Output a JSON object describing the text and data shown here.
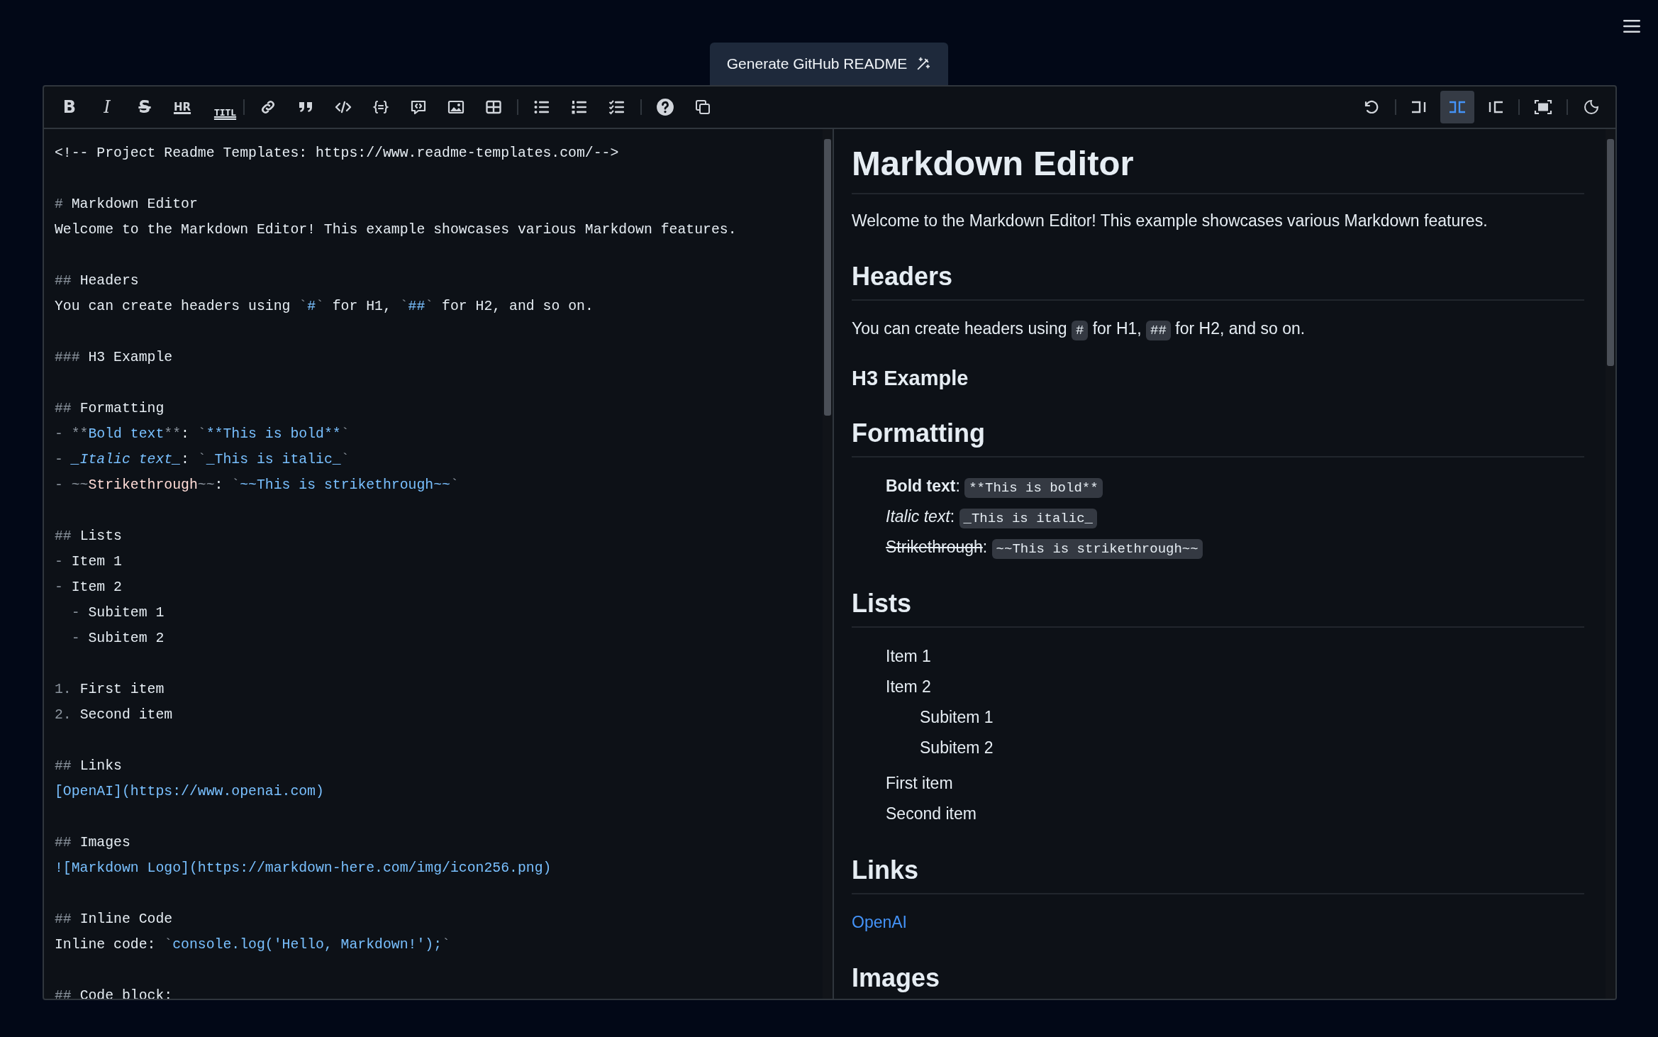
{
  "generate_button": {
    "label": "Generate GitHub README"
  },
  "toolbar": {
    "left_groups": [
      [
        {
          "kind": "label",
          "label": "B"
        },
        {
          "kind": "label",
          "label": "I"
        },
        {
          "kind": "label",
          "label": "S"
        },
        {
          "kind": "label",
          "label": "HR"
        },
        {
          "kind": "label",
          "label": "TITL"
        }
      ],
      [
        {
          "kind": "link"
        },
        {
          "kind": "quote"
        },
        {
          "kind": "code"
        },
        {
          "kind": "code-block"
        },
        {
          "kind": "comment"
        },
        {
          "kind": "image"
        },
        {
          "kind": "table"
        }
      ],
      [
        {
          "kind": "bullet-list"
        },
        {
          "kind": "numbered-list"
        },
        {
          "kind": "task-list"
        }
      ],
      [
        {
          "kind": "help"
        },
        {
          "kind": "copy"
        }
      ]
    ],
    "right_groups": [
      [
        {
          "kind": "undo",
          "selected": false
        }
      ],
      [
        {
          "kind": "pane-editor",
          "selected": false
        },
        {
          "kind": "pane-split",
          "selected": true
        },
        {
          "kind": "pane-preview",
          "selected": false
        }
      ],
      [
        {
          "kind": "fullscreen",
          "selected": false
        }
      ],
      [
        {
          "kind": "theme",
          "selected": false
        }
      ]
    ]
  },
  "editor": {
    "paragraphs": [
      {
        "lines": [
          [
            {
              "kind": "plain",
              "text": "<!-- Project Readme Templates: https://www.readme-templates.com/-->"
            }
          ]
        ]
      },
      {
        "lines": [
          [
            {
              "kind": "mark",
              "text": "# "
            },
            {
              "kind": "plain",
              "text": "Markdown Editor"
            }
          ],
          [
            {
              "kind": "plain",
              "text": "Welcome to the Markdown Editor! This example showcases various Markdown features."
            }
          ]
        ]
      },
      {
        "lines": [
          [
            {
              "kind": "mark",
              "text": "## "
            },
            {
              "kind": "plain",
              "text": "Headers"
            }
          ],
          [
            {
              "kind": "plain",
              "text": "You can create headers using "
            },
            {
              "kind": "mark",
              "text": "`"
            },
            {
              "kind": "code",
              "text": "#"
            },
            {
              "kind": "mark",
              "text": "`"
            },
            {
              "kind": "plain",
              "text": " for H1, "
            },
            {
              "kind": "mark",
              "text": "`"
            },
            {
              "kind": "code",
              "text": "##"
            },
            {
              "kind": "mark",
              "text": "`"
            },
            {
              "kind": "plain",
              "text": " for H2, and so on."
            }
          ]
        ]
      },
      {
        "lines": [
          [
            {
              "kind": "mark",
              "text": "### "
            },
            {
              "kind": "plain",
              "text": "H3 Example"
            }
          ]
        ]
      },
      {
        "lines": [
          [
            {
              "kind": "mark",
              "text": "## "
            },
            {
              "kind": "plain",
              "text": "Formatting"
            }
          ],
          [
            {
              "kind": "mark",
              "text": "- **"
            },
            {
              "kind": "code",
              "text": "Bold text"
            },
            {
              "kind": "mark",
              "text": "**"
            },
            {
              "kind": "plain",
              "text": ": "
            },
            {
              "kind": "mark",
              "text": "`"
            },
            {
              "kind": "code",
              "text": "**This is bold**"
            },
            {
              "kind": "mark",
              "text": "`"
            }
          ],
          [
            {
              "kind": "mark",
              "text": "- "
            },
            {
              "kind": "italic",
              "text": "_Italic text_"
            },
            {
              "kind": "plain",
              "text": ": "
            },
            {
              "kind": "mark",
              "text": "`"
            },
            {
              "kind": "code",
              "text": "_This is italic_"
            },
            {
              "kind": "mark",
              "text": "`"
            }
          ],
          [
            {
              "kind": "mark",
              "text": "- ~~"
            },
            {
              "kind": "strike",
              "text": "Strikethrough"
            },
            {
              "kind": "mark",
              "text": "~~"
            },
            {
              "kind": "plain",
              "text": ": "
            },
            {
              "kind": "mark",
              "text": "`"
            },
            {
              "kind": "code",
              "text": "~~This is strikethrough~~"
            },
            {
              "kind": "mark",
              "text": "`"
            }
          ]
        ]
      },
      {
        "lines": [
          [
            {
              "kind": "mark",
              "text": "## "
            },
            {
              "kind": "plain",
              "text": "Lists"
            }
          ],
          [
            {
              "kind": "mark",
              "text": "- "
            },
            {
              "kind": "plain",
              "text": "Item 1"
            }
          ],
          [
            {
              "kind": "mark",
              "text": "- "
            },
            {
              "kind": "plain",
              "text": "Item 2"
            }
          ],
          [
            {
              "kind": "mark",
              "text": "  - "
            },
            {
              "kind": "plain",
              "text": "Subitem 1"
            }
          ],
          [
            {
              "kind": "mark",
              "text": "  - "
            },
            {
              "kind": "plain",
              "text": "Subitem 2"
            }
          ]
        ]
      },
      {
        "lines": [
          [
            {
              "kind": "mark",
              "text": "1. "
            },
            {
              "kind": "plain",
              "text": "First item"
            }
          ],
          [
            {
              "kind": "mark",
              "text": "2. "
            },
            {
              "kind": "plain",
              "text": "Second item"
            }
          ]
        ]
      },
      {
        "lines": [
          [
            {
              "kind": "mark",
              "text": "## "
            },
            {
              "kind": "plain",
              "text": "Links"
            }
          ],
          [
            {
              "kind": "code",
              "text": "[OpenAI](https://www.openai.com)"
            }
          ]
        ]
      },
      {
        "lines": [
          [
            {
              "kind": "mark",
              "text": "## "
            },
            {
              "kind": "plain",
              "text": "Images"
            }
          ],
          [
            {
              "kind": "code",
              "text": "![Markdown Logo](https://markdown-here.com/img/icon256.png)"
            }
          ]
        ]
      },
      {
        "lines": [
          [
            {
              "kind": "mark",
              "text": "## "
            },
            {
              "kind": "plain",
              "text": "Inline Code"
            }
          ],
          [
            {
              "kind": "plain",
              "text": "Inline code: "
            },
            {
              "kind": "mark",
              "text": "`"
            },
            {
              "kind": "code",
              "text": "console.log('Hello, Markdown!');"
            },
            {
              "kind": "mark",
              "text": "`"
            }
          ]
        ]
      },
      {
        "lines": [
          [
            {
              "kind": "mark",
              "text": "## "
            },
            {
              "kind": "plain",
              "text": "Code block:"
            }
          ]
        ]
      }
    ]
  },
  "preview": {
    "blocks": [
      {
        "kind": "h1",
        "text": "Markdown Editor"
      },
      {
        "kind": "p",
        "segments": [
          {
            "kind": "plain",
            "text": "Welcome to the Markdown Editor! This example showcases various Markdown features."
          }
        ]
      },
      {
        "kind": "h2",
        "text": "Headers"
      },
      {
        "kind": "p",
        "segments": [
          {
            "kind": "plain",
            "text": "You can create headers using "
          },
          {
            "kind": "code",
            "text": "#"
          },
          {
            "kind": "plain",
            "text": " for H1, "
          },
          {
            "kind": "code",
            "text": "##"
          },
          {
            "kind": "plain",
            "text": " for H2, and so on."
          }
        ]
      },
      {
        "kind": "h3",
        "text": "H3 Example"
      },
      {
        "kind": "h2",
        "text": "Formatting"
      },
      {
        "kind": "list",
        "items": [
          {
            "segments": [
              {
                "kind": "bold",
                "text": "Bold text"
              },
              {
                "kind": "plain",
                "text": ": "
              },
              {
                "kind": "code",
                "text": "**This is bold**"
              }
            ]
          },
          {
            "segments": [
              {
                "kind": "italic",
                "text": "Italic text"
              },
              {
                "kind": "plain",
                "text": ": "
              },
              {
                "kind": "code",
                "text": "_This is italic_"
              }
            ]
          },
          {
            "segments": [
              {
                "kind": "strike",
                "text": "Strikethrough"
              },
              {
                "kind": "plain",
                "text": ": "
              },
              {
                "kind": "code",
                "text": "~~This is strikethrough~~"
              }
            ]
          }
        ]
      },
      {
        "kind": "h2",
        "text": "Lists"
      },
      {
        "kind": "list",
        "items": [
          {
            "segments": [
              {
                "kind": "plain",
                "text": "Item 1"
              }
            ]
          },
          {
            "segments": [
              {
                "kind": "plain",
                "text": "Item 2"
              }
            ],
            "children": [
              {
                "segments": [
                  {
                    "kind": "plain",
                    "text": "Subitem 1"
                  }
                ]
              },
              {
                "segments": [
                  {
                    "kind": "plain",
                    "text": "Subitem 2"
                  }
                ]
              }
            ]
          }
        ]
      },
      {
        "kind": "list",
        "items": [
          {
            "segments": [
              {
                "kind": "plain",
                "text": "First item"
              }
            ]
          },
          {
            "segments": [
              {
                "kind": "plain",
                "text": "Second item"
              }
            ]
          }
        ]
      },
      {
        "kind": "h2",
        "text": "Links"
      },
      {
        "kind": "p",
        "segments": [
          {
            "kind": "link",
            "text": "OpenAI"
          }
        ]
      },
      {
        "kind": "h2",
        "text": "Images"
      }
    ]
  }
}
